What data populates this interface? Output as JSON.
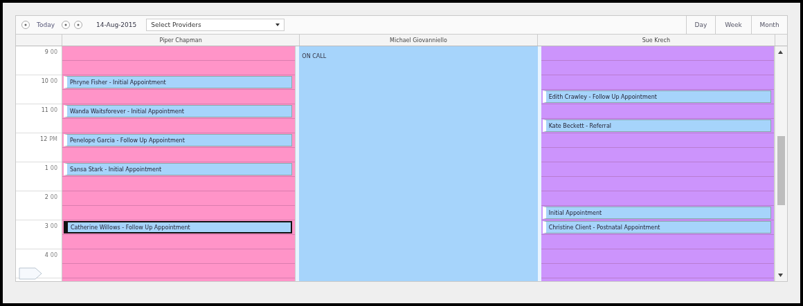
{
  "toolbar": {
    "today": "Today",
    "date": "14-Aug-2015",
    "provider_select": {
      "placeholder": "Select Providers"
    },
    "views": [
      "Day",
      "Week",
      "Month"
    ]
  },
  "times": [
    {
      "hour": "9",
      "suffix": "00"
    },
    {
      "hour": "10",
      "suffix": "00"
    },
    {
      "hour": "11",
      "suffix": "00"
    },
    {
      "hour": "12",
      "suffix": "PM"
    },
    {
      "hour": "1",
      "suffix": "00"
    },
    {
      "hour": "2",
      "suffix": "00"
    },
    {
      "hour": "3",
      "suffix": "00"
    },
    {
      "hour": "4",
      "suffix": "00"
    }
  ],
  "providers": [
    {
      "name": "Piper Chapman",
      "kind": "schedule",
      "color": "#ff94c8",
      "slots": [
        {
          "kind": "free"
        },
        {
          "kind": "free"
        },
        {
          "kind": "appointment",
          "text": "Phryne Fisher - Initial Appointment",
          "selected": false
        },
        {
          "kind": "free"
        },
        {
          "kind": "appointment",
          "text": "Wanda Waitsforever - Initial Appointment",
          "selected": false
        },
        {
          "kind": "free"
        },
        {
          "kind": "appointment",
          "text": "Penelope Garcia - Follow Up Appointment",
          "selected": false
        },
        {
          "kind": "free"
        },
        {
          "kind": "appointment",
          "text": "Sansa Stark - Initial Appointment",
          "selected": false
        },
        {
          "kind": "free"
        },
        {
          "kind": "free"
        },
        {
          "kind": "free"
        },
        {
          "kind": "appointment",
          "text": "Catherine Willows - Follow Up Appointment",
          "selected": true
        },
        {
          "kind": "free"
        },
        {
          "kind": "free"
        },
        {
          "kind": "free"
        }
      ]
    },
    {
      "name": "Michael Giovanniello",
      "kind": "on_call",
      "color": "#a6d4fb",
      "label": "ON CALL"
    },
    {
      "name": "Sue Krech",
      "kind": "schedule",
      "color": "#cc94fc",
      "slots": [
        {
          "kind": "free"
        },
        {
          "kind": "free"
        },
        {
          "kind": "free"
        },
        {
          "kind": "appointment",
          "text": "Edith Crawley - Follow Up Appointment",
          "selected": false
        },
        {
          "kind": "free"
        },
        {
          "kind": "appointment",
          "text": "Kate Beckett - Referral",
          "selected": false
        },
        {
          "kind": "free"
        },
        {
          "kind": "free"
        },
        {
          "kind": "free"
        },
        {
          "kind": "free"
        },
        {
          "kind": "free"
        },
        {
          "kind": "appointment",
          "text": "Initial Appointment",
          "selected": false
        },
        {
          "kind": "appointment",
          "text": "Christine Client - Postnatal Appointment",
          "selected": false
        },
        {
          "kind": "free"
        },
        {
          "kind": "free"
        },
        {
          "kind": "free"
        }
      ]
    }
  ]
}
